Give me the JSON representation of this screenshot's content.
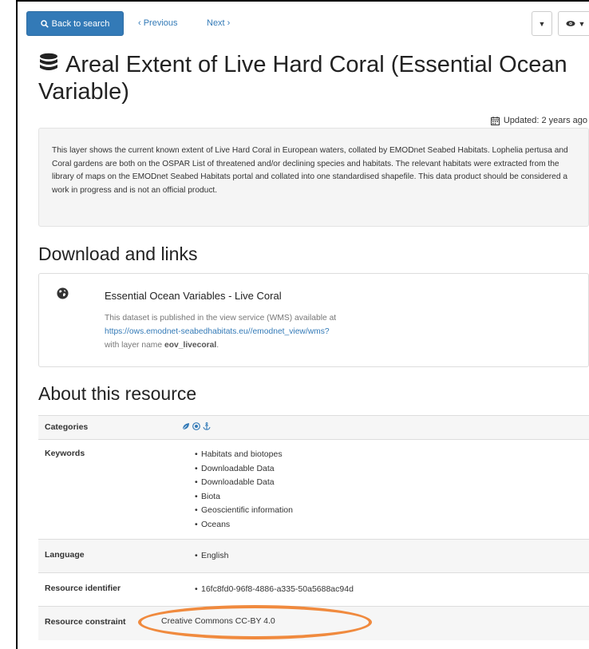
{
  "toolbar": {
    "back_label": "Back to search",
    "prev_label": "‹ Previous",
    "next_label": "Next ›"
  },
  "record": {
    "title": "Areal Extent of Live Hard Coral (Essential Ocean Variable)",
    "updated": "Updated: 2 years ago",
    "abstract": "This layer shows the current known extent of Live Hard Coral in European waters, collated by EMODnet Seabed Habitats. Lophelia pertusa and Coral gardens are both on the OSPAR List of threatened and/or declining species and habitats. The relevant habitats were extracted from the library of maps on the EMODnet Seabed Habitats portal and collated into one standardised shapefile. This data product should be considered a work in progress and is not an official product."
  },
  "download": {
    "heading": "Download and links",
    "link_title": "Essential Ocean Variables - Live Coral",
    "desc_prefix": "This dataset is published in the view service (WMS) available at",
    "url": "https://ows.emodnet-seabedhabitats.eu//emodnet_view/wms?",
    "layer_prefix": "with layer name",
    "layer_name": "eov_livecoral",
    "layer_suffix": "."
  },
  "about": {
    "heading": "About this resource",
    "categories_label": "Categories",
    "keywords_label": "Keywords",
    "keywords": [
      "Habitats and biotopes",
      "Downloadable Data",
      "Downloadable Data",
      "Biota",
      "Geoscientific information",
      "Oceans"
    ],
    "language_label": "Language",
    "language": "English",
    "identifier_label": "Resource identifier",
    "identifier": "16fc8fd0-96f8-4886-a335-50a5688ac94d",
    "constraint_label": "Resource constraint",
    "constraint": "Creative Commons CC-BY 4.0"
  },
  "icons": {
    "back": "search-icon",
    "caret": "caret-down-icon",
    "eye": "eye-icon",
    "title": "database-icon",
    "updated": "calendar-icon",
    "link": "globe-icon",
    "categories": [
      "leaf-icon",
      "globe-icon",
      "anchor-icon"
    ]
  },
  "colors": {
    "primary": "#337ab7",
    "highlight": "#f08a3e"
  }
}
